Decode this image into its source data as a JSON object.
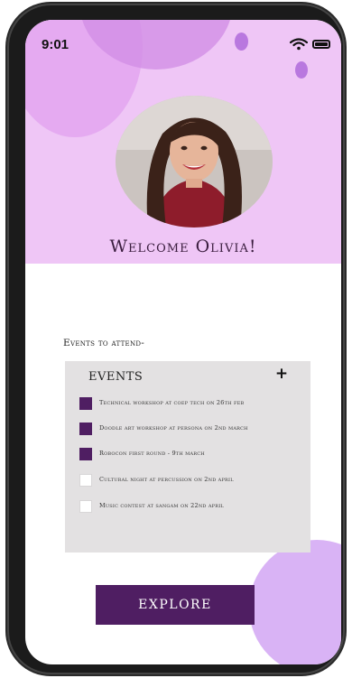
{
  "status_bar": {
    "time": "9:01"
  },
  "profile": {
    "welcome": "Welcome Olivia!"
  },
  "events_section": {
    "heading": "Events to attend-",
    "panel_title": "EVENTS",
    "add_label": "+",
    "items": [
      {
        "label": "Technical workshop at coep tech on 26th feb",
        "checked": true
      },
      {
        "label": "Doodle art workshop at persona on 2nd march",
        "checked": true
      },
      {
        "label": "Robocon first round - 9th march",
        "checked": true
      },
      {
        "label": "Cultural night at percussion on 2nd april",
        "checked": false
      },
      {
        "label": "Music contest at sangam on 22nd april",
        "checked": false
      }
    ]
  },
  "explore_label": "EXPLORE",
  "colors": {
    "header": "#efc6f6",
    "accent": "#4f1e62",
    "panel": "#e3e1e2"
  },
  "icons": [
    "wifi-icon",
    "battery-icon",
    "plus-icon"
  ]
}
